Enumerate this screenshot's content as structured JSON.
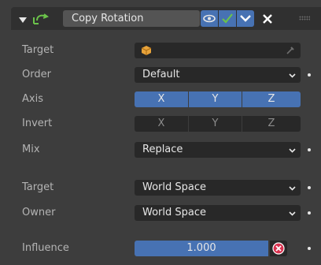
{
  "header": {
    "constraint_name": "Copy Rotation",
    "icons": [
      "expand-triangle-icon",
      "copy-rotation-constraint-icon",
      "eye-icon",
      "check-icon",
      "chevron-down-icon",
      "close-icon",
      "drag-grip-icon"
    ]
  },
  "rows": {
    "target_label": "Target",
    "order_label": "Order",
    "order_value": "Default",
    "axis_label": "Axis",
    "axis_x": "X",
    "axis_y": "Y",
    "axis_z": "Z",
    "invert_label": "Invert",
    "invert_x": "X",
    "invert_y": "Y",
    "invert_z": "Z",
    "mix_label": "Mix",
    "mix_value": "Replace",
    "target_space_label": "Target",
    "target_space_value": "World Space",
    "owner_space_label": "Owner",
    "owner_space_value": "World Space",
    "influence_label": "Influence",
    "influence_value": "1.000"
  },
  "colors": {
    "accent": "#4772b3",
    "panel": "#3d3d3d",
    "field": "#282828",
    "check_green": "#6bc34a",
    "cube_orange": "#e8a33a",
    "remove_red": "#d8324f"
  }
}
